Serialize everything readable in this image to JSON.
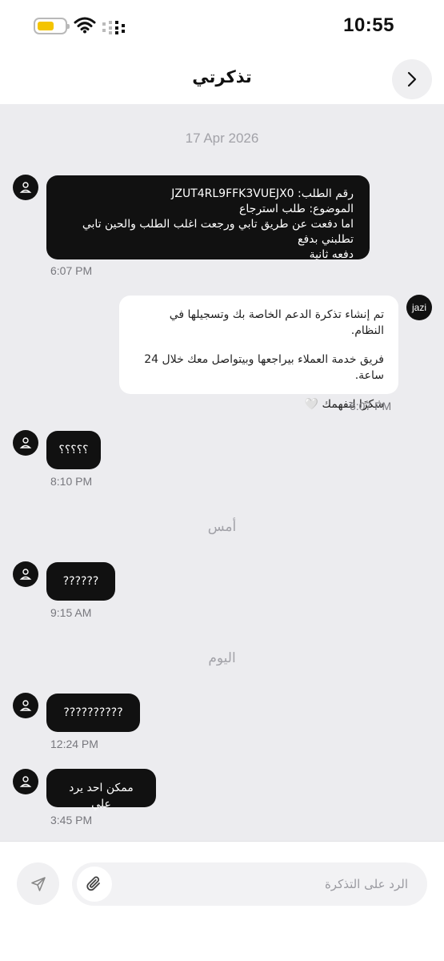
{
  "status_bar": {
    "time": "10:55",
    "battery_color": "#f4c400"
  },
  "header": {
    "title": "تذكرتي",
    "back_icon": "chevron-right-icon"
  },
  "colors": {
    "chat_bg": "#ececef",
    "user_bubble": "#111111",
    "agent_bubble": "#ffffff",
    "accent": "#111111"
  },
  "separators": {
    "first_date": "17 Apr 2026",
    "yesterday": "أمس",
    "today": "اليوم"
  },
  "messages": {
    "m1": {
      "lines": [
        "رقم الطلب: JZUT4RL9FFK3VUEJX0",
        "الموضوع: طلب استرجاع",
        "اما دفعت عن طريق تابي ورجعت اغلب الطلب والحين تابي تطلبني بدفع",
        "دفعه ثانية"
      ],
      "time": "6:07 PM"
    },
    "m2": {
      "sender": "jazi",
      "lines": [
        "تم إنشاء تذكرة الدعم الخاصة بك وتسجيلها في النظام.",
        "فريق خدمة العملاء بيراجعها وبيتواصل معك خلال 24 ساعة.",
        "شكرًا لتفهمك 🤍"
      ],
      "time": "6:07 PM"
    },
    "m3": {
      "text": "؟؟؟؟؟",
      "time": "8:10 PM"
    },
    "m4": {
      "text": "??????",
      "time": "9:15 AM"
    },
    "m5": {
      "text": "??????????",
      "time": "12:24 PM"
    },
    "m6": {
      "text": "ممكن احد يرد علي",
      "time": "3:45 PM"
    }
  },
  "composer": {
    "placeholder": "الرد على التذكرة",
    "value": ""
  }
}
